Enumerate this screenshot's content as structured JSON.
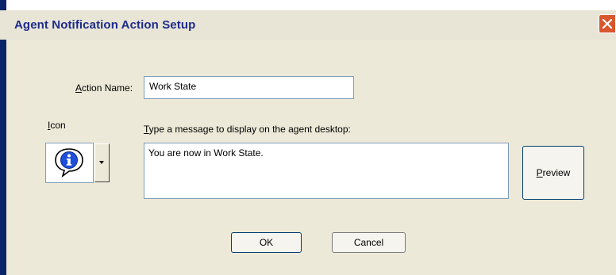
{
  "window": {
    "title": "Agent Notification Action Setup"
  },
  "form": {
    "action_name_label_prefix": "A",
    "action_name_label_rest": "ction Name:",
    "action_name_value": "Work State",
    "icon_label_prefix": "I",
    "icon_label_rest": "con",
    "icon_selected": "info-speech-bubble-icon",
    "message_label_prefix": "T",
    "message_label_rest": "ype a message to display on the agent desktop:",
    "message_value": "You are now in Work State."
  },
  "buttons": {
    "preview_prefix": "P",
    "preview_rest": "review",
    "ok": "OK",
    "cancel": "Cancel"
  },
  "colors": {
    "title_text": "#1e2b8a",
    "close_button": "#d9562e",
    "dialog_background": "#ece9d8",
    "field_border": "#7f9db9"
  }
}
